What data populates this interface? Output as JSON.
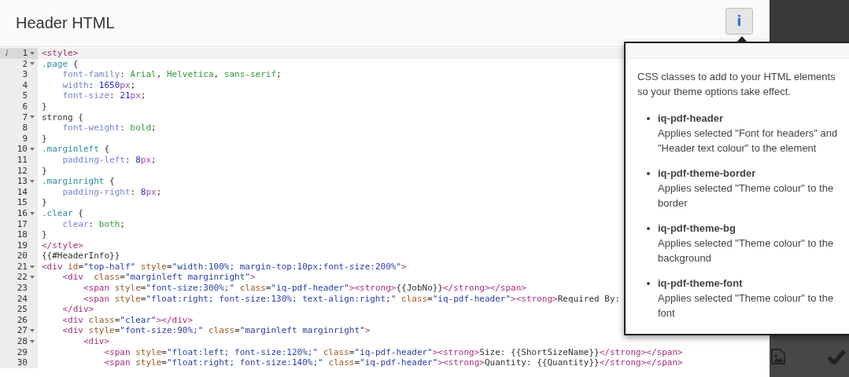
{
  "header": {
    "title": "Header HTML",
    "info_button": {
      "label": "i",
      "pressed": true
    }
  },
  "editor": {
    "lines": [
      {
        "no": "1",
        "fold": true,
        "active": true,
        "annotated": true,
        "tokens": [
          {
            "kind": "tag",
            "text": "<style>"
          }
        ]
      },
      {
        "no": "2",
        "fold": true,
        "active": false,
        "annotated": false,
        "tokens": [
          {
            "kind": "sel",
            "text": ".page"
          },
          {
            "kind": "plain",
            "text": " {"
          }
        ]
      },
      {
        "no": "3",
        "fold": false,
        "active": false,
        "annotated": false,
        "tokens": [
          {
            "kind": "prop",
            "text": "    font-family"
          },
          {
            "kind": "plain",
            "text": ": "
          },
          {
            "kind": "val",
            "text": "Arial"
          },
          {
            "kind": "plain",
            "text": ", "
          },
          {
            "kind": "val",
            "text": "Helvetica"
          },
          {
            "kind": "plain",
            "text": ", "
          },
          {
            "kind": "val",
            "text": "sans-serif"
          },
          {
            "kind": "plain",
            "text": ";"
          }
        ]
      },
      {
        "no": "4",
        "fold": false,
        "active": false,
        "annotated": false,
        "tokens": [
          {
            "kind": "prop",
            "text": "    width"
          },
          {
            "kind": "plain",
            "text": ": "
          },
          {
            "kind": "num",
            "text": "1650"
          },
          {
            "kind": "unit",
            "text": "px"
          },
          {
            "kind": "plain",
            "text": ";"
          }
        ]
      },
      {
        "no": "5",
        "fold": false,
        "active": false,
        "annotated": false,
        "tokens": [
          {
            "kind": "prop",
            "text": "    font-size"
          },
          {
            "kind": "plain",
            "text": ": "
          },
          {
            "kind": "num",
            "text": "21"
          },
          {
            "kind": "unit",
            "text": "px"
          },
          {
            "kind": "plain",
            "text": ";"
          }
        ]
      },
      {
        "no": "6",
        "fold": false,
        "active": false,
        "annotated": false,
        "tokens": [
          {
            "kind": "plain",
            "text": "}"
          }
        ]
      },
      {
        "no": "7",
        "fold": true,
        "active": false,
        "annotated": false,
        "tokens": [
          {
            "kind": "plain",
            "text": "strong {"
          }
        ]
      },
      {
        "no": "8",
        "fold": false,
        "active": false,
        "annotated": false,
        "tokens": [
          {
            "kind": "prop",
            "text": "    font-weight"
          },
          {
            "kind": "plain",
            "text": ": "
          },
          {
            "kind": "val",
            "text": "bold"
          },
          {
            "kind": "plain",
            "text": ";"
          }
        ]
      },
      {
        "no": "9",
        "fold": false,
        "active": false,
        "annotated": false,
        "tokens": [
          {
            "kind": "plain",
            "text": "}"
          }
        ]
      },
      {
        "no": "10",
        "fold": true,
        "active": false,
        "annotated": false,
        "tokens": [
          {
            "kind": "sel",
            "text": ".marginleft"
          },
          {
            "kind": "plain",
            "text": " {"
          }
        ]
      },
      {
        "no": "11",
        "fold": false,
        "active": false,
        "annotated": false,
        "tokens": [
          {
            "kind": "prop",
            "text": "    padding-left"
          },
          {
            "kind": "plain",
            "text": ": "
          },
          {
            "kind": "num",
            "text": "8"
          },
          {
            "kind": "unit",
            "text": "px"
          },
          {
            "kind": "plain",
            "text": ";"
          }
        ]
      },
      {
        "no": "12",
        "fold": false,
        "active": false,
        "annotated": false,
        "tokens": [
          {
            "kind": "plain",
            "text": "}"
          }
        ]
      },
      {
        "no": "13",
        "fold": true,
        "active": false,
        "annotated": false,
        "tokens": [
          {
            "kind": "sel",
            "text": ".marginright"
          },
          {
            "kind": "plain",
            "text": " {"
          }
        ]
      },
      {
        "no": "14",
        "fold": false,
        "active": false,
        "annotated": false,
        "tokens": [
          {
            "kind": "prop",
            "text": "    padding-right"
          },
          {
            "kind": "plain",
            "text": ": "
          },
          {
            "kind": "num",
            "text": "8"
          },
          {
            "kind": "unit",
            "text": "px"
          },
          {
            "kind": "plain",
            "text": ";"
          }
        ]
      },
      {
        "no": "15",
        "fold": false,
        "active": false,
        "annotated": false,
        "tokens": [
          {
            "kind": "plain",
            "text": "}"
          }
        ]
      },
      {
        "no": "16",
        "fold": true,
        "active": false,
        "annotated": false,
        "tokens": [
          {
            "kind": "sel",
            "text": ".clear"
          },
          {
            "kind": "plain",
            "text": " {"
          }
        ]
      },
      {
        "no": "17",
        "fold": false,
        "active": false,
        "annotated": false,
        "tokens": [
          {
            "kind": "prop",
            "text": "    clear"
          },
          {
            "kind": "plain",
            "text": ": "
          },
          {
            "kind": "val",
            "text": "both"
          },
          {
            "kind": "plain",
            "text": ";"
          }
        ]
      },
      {
        "no": "18",
        "fold": false,
        "active": false,
        "annotated": false,
        "tokens": [
          {
            "kind": "plain",
            "text": "}"
          }
        ]
      },
      {
        "no": "19",
        "fold": false,
        "active": false,
        "annotated": false,
        "tokens": [
          {
            "kind": "tag",
            "text": "</style>"
          }
        ]
      },
      {
        "no": "20",
        "fold": false,
        "active": false,
        "annotated": false,
        "tokens": [
          {
            "kind": "plain",
            "text": "{{#HeaderInfo}}"
          }
        ]
      },
      {
        "no": "21",
        "fold": true,
        "active": false,
        "annotated": false,
        "tokens": [
          {
            "kind": "tag",
            "text": "<div"
          },
          {
            "kind": "attr",
            "text": " id"
          },
          {
            "kind": "plain",
            "text": "="
          },
          {
            "kind": "str",
            "text": "\"top-half\""
          },
          {
            "kind": "attr",
            "text": " style"
          },
          {
            "kind": "plain",
            "text": "="
          },
          {
            "kind": "str",
            "text": "\"width:100%; margin-top:10px;font-size:200%\""
          },
          {
            "kind": "tag",
            "text": ">"
          }
        ]
      },
      {
        "no": "22",
        "fold": true,
        "active": false,
        "annotated": false,
        "tokens": [
          {
            "kind": "tag",
            "text": "    <div"
          },
          {
            "kind": "attr",
            "text": "  class"
          },
          {
            "kind": "plain",
            "text": "="
          },
          {
            "kind": "str",
            "text": "\"marginleft marginright\""
          },
          {
            "kind": "tag",
            "text": ">"
          }
        ]
      },
      {
        "no": "23",
        "fold": false,
        "active": false,
        "annotated": false,
        "tokens": [
          {
            "kind": "tag",
            "text": "        <span"
          },
          {
            "kind": "attr",
            "text": " style"
          },
          {
            "kind": "plain",
            "text": "="
          },
          {
            "kind": "str",
            "text": "\"font-size:300%;\""
          },
          {
            "kind": "attr",
            "text": " class"
          },
          {
            "kind": "plain",
            "text": "="
          },
          {
            "kind": "str",
            "text": "\"iq-pdf-header\""
          },
          {
            "kind": "tag",
            "text": "><strong>"
          },
          {
            "kind": "plain",
            "text": "{{JobNo}}"
          },
          {
            "kind": "tag",
            "text": "</strong></span>"
          }
        ]
      },
      {
        "no": "24",
        "fold": false,
        "active": false,
        "annotated": false,
        "tokens": [
          {
            "kind": "tag",
            "text": "        <span"
          },
          {
            "kind": "attr",
            "text": " style"
          },
          {
            "kind": "plain",
            "text": "="
          },
          {
            "kind": "str",
            "text": "\"float:right; font-size:130%; text-align:right;\""
          },
          {
            "kind": "attr",
            "text": " class"
          },
          {
            "kind": "plain",
            "text": "="
          },
          {
            "kind": "str",
            "text": "\"iq-pdf-header\""
          },
          {
            "kind": "tag",
            "text": "><strong>"
          },
          {
            "kind": "plain",
            "text": "Required By:"
          }
        ]
      },
      {
        "no": "25",
        "fold": false,
        "active": false,
        "annotated": false,
        "tokens": [
          {
            "kind": "tag",
            "text": "    </div>"
          }
        ]
      },
      {
        "no": "26",
        "fold": false,
        "active": false,
        "annotated": false,
        "tokens": [
          {
            "kind": "tag",
            "text": "    <div"
          },
          {
            "kind": "attr",
            "text": " class"
          },
          {
            "kind": "plain",
            "text": "="
          },
          {
            "kind": "str",
            "text": "\"clear\""
          },
          {
            "kind": "tag",
            "text": "></div>"
          }
        ]
      },
      {
        "no": "27",
        "fold": true,
        "active": false,
        "annotated": false,
        "tokens": [
          {
            "kind": "tag",
            "text": "    <div"
          },
          {
            "kind": "attr",
            "text": " style"
          },
          {
            "kind": "plain",
            "text": "="
          },
          {
            "kind": "str",
            "text": "\"font-size:90%;\""
          },
          {
            "kind": "attr",
            "text": " class"
          },
          {
            "kind": "plain",
            "text": "="
          },
          {
            "kind": "str",
            "text": "\"marginleft marginright\""
          },
          {
            "kind": "tag",
            "text": ">"
          }
        ]
      },
      {
        "no": "28",
        "fold": true,
        "active": false,
        "annotated": false,
        "tokens": [
          {
            "kind": "tag",
            "text": "        <div>"
          }
        ]
      },
      {
        "no": "29",
        "fold": false,
        "active": false,
        "annotated": false,
        "tokens": [
          {
            "kind": "tag",
            "text": "            <span"
          },
          {
            "kind": "attr",
            "text": " style"
          },
          {
            "kind": "plain",
            "text": "="
          },
          {
            "kind": "str",
            "text": "\"float:left; font-size:120%;\""
          },
          {
            "kind": "attr",
            "text": " class"
          },
          {
            "kind": "plain",
            "text": "="
          },
          {
            "kind": "str",
            "text": "\"iq-pdf-header\""
          },
          {
            "kind": "tag",
            "text": "><strong>"
          },
          {
            "kind": "plain",
            "text": "Size: {{ShortSizeName}}"
          },
          {
            "kind": "tag",
            "text": "</strong></span>"
          }
        ]
      },
      {
        "no": "30",
        "fold": false,
        "active": false,
        "annotated": false,
        "tokens": [
          {
            "kind": "tag",
            "text": "            <span"
          },
          {
            "kind": "attr",
            "text": " style"
          },
          {
            "kind": "plain",
            "text": "="
          },
          {
            "kind": "str",
            "text": "\"float:right; font-size:140%;\""
          },
          {
            "kind": "attr",
            "text": " class"
          },
          {
            "kind": "plain",
            "text": "="
          },
          {
            "kind": "str",
            "text": "\"iq-pdf-header\""
          },
          {
            "kind": "tag",
            "text": "><strong>"
          },
          {
            "kind": "plain",
            "text": "Quantity: {{Quantity}}"
          },
          {
            "kind": "tag",
            "text": "</strong></span>"
          }
        ]
      }
    ]
  },
  "popover": {
    "intro": "CSS classes to add to your HTML elements so your theme options take effect.",
    "items": [
      {
        "name": "iq-pdf-header",
        "description": "Applies selected \"Font for headers\" and \"Header text colour\" to the element"
      },
      {
        "name": "iq-pdf-theme-border",
        "description": "Applies selected \"Theme colour\" to the border"
      },
      {
        "name": "iq-pdf-theme-bg",
        "description": "Applies selected \"Theme colour\" to the background"
      },
      {
        "name": "iq-pdf-theme-font",
        "description": "Applies selected \"Theme colour\" to the font"
      }
    ]
  }
}
